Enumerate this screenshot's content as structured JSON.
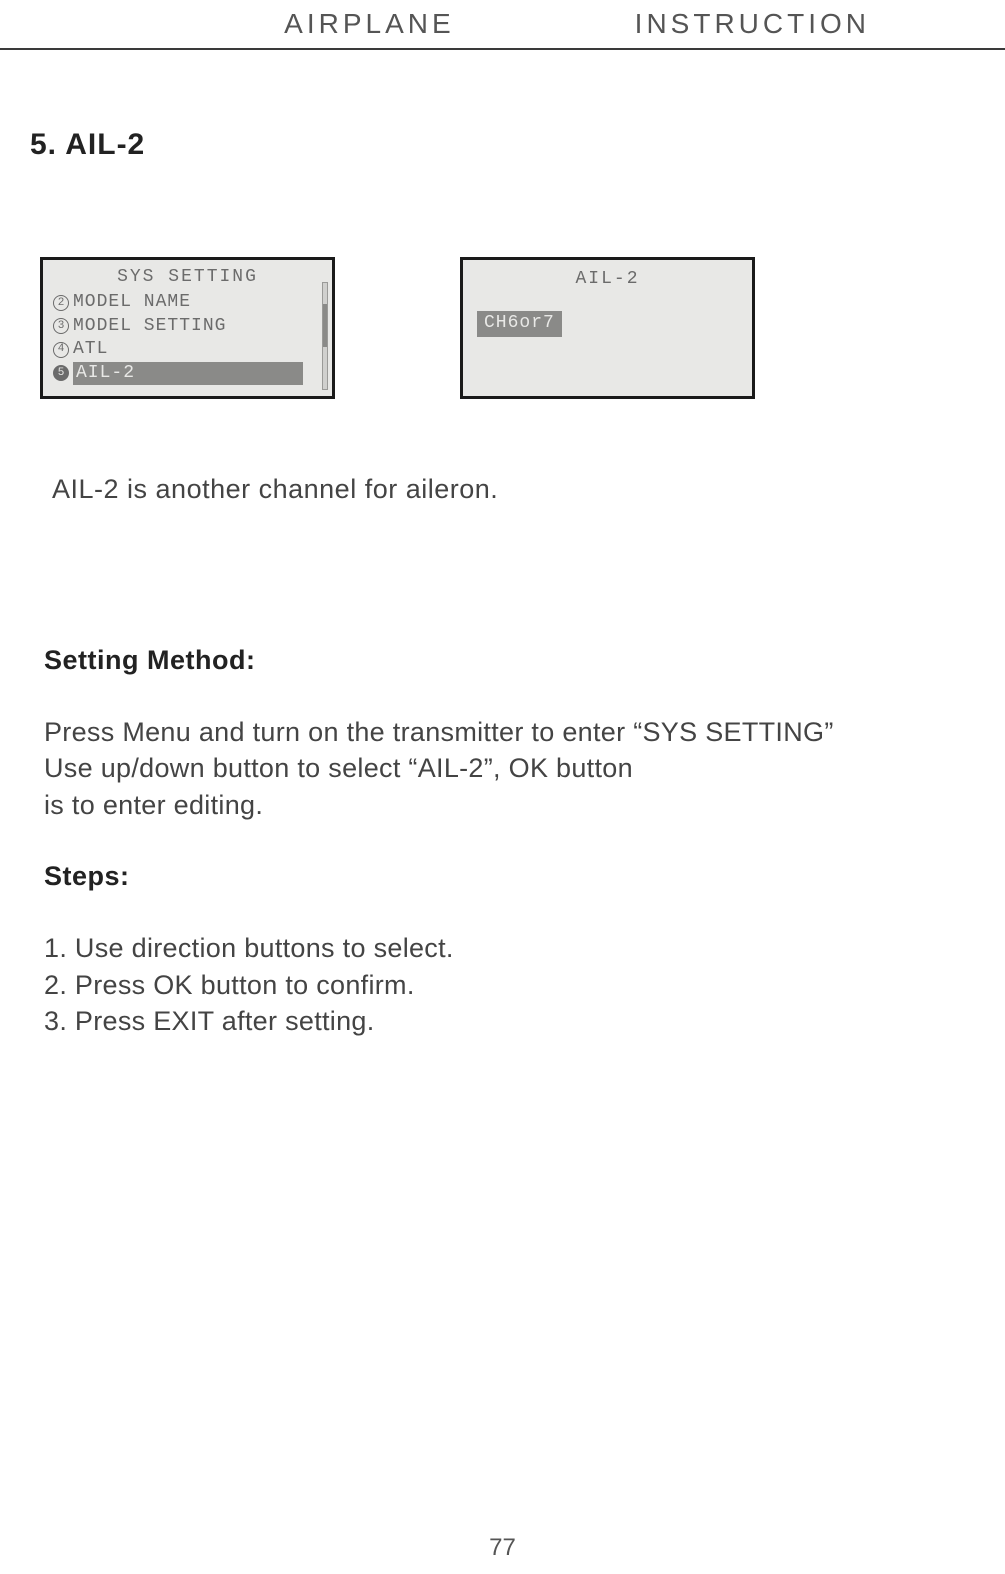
{
  "header": {
    "left": "AIRPLANE",
    "right": "INSTRUCTION"
  },
  "section_title": "5. AIL-2",
  "lcd_left": {
    "title": "SYS SETTING",
    "items": [
      {
        "num": "2",
        "label": "MODEL NAME",
        "selected": false
      },
      {
        "num": "3",
        "label": "MODEL SETTING",
        "selected": false
      },
      {
        "num": "4",
        "label": "ATL",
        "selected": false
      },
      {
        "num": "5",
        "label": "AIL-2",
        "selected": true
      }
    ]
  },
  "lcd_right": {
    "title": "AIL-2",
    "option": "CH6or7"
  },
  "intro": "AIL-2 is another channel for aileron.",
  "method_heading": "Setting Method:",
  "method_text_l1": "Press Menu and turn on the transmitter to enter “SYS SETTING”",
  "method_text_l2": "Use up/down button to select “AIL-2”, OK button",
  "method_text_l3": "is to enter editing.",
  "steps_heading": "Steps:",
  "steps": [
    "1. Use direction buttons to select.",
    "2. Press OK button to confirm.",
    "3. Press EXIT after setting."
  ],
  "page_number": "77"
}
